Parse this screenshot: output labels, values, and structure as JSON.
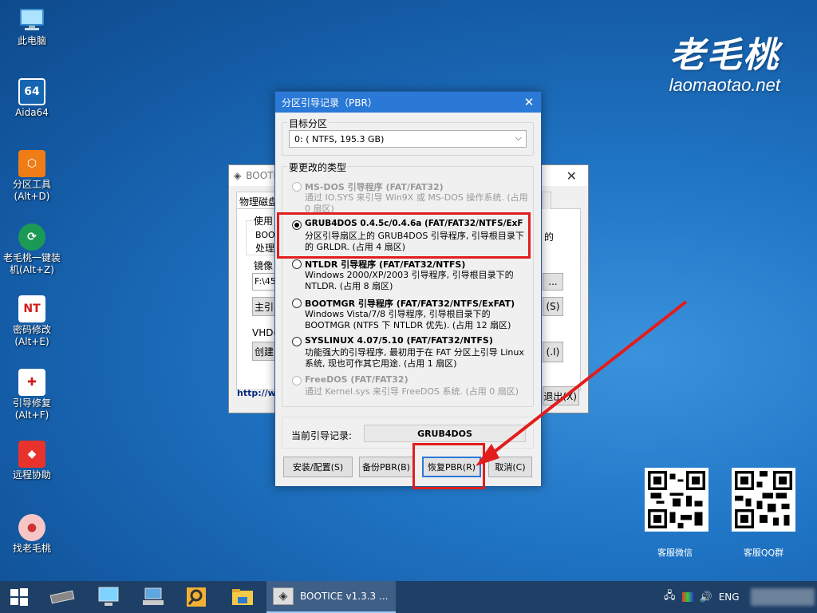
{
  "desktop": {
    "icons": [
      {
        "label": "此电脑",
        "icon": "computer-icon"
      },
      {
        "label": "Aida64",
        "icon": "aida64-icon",
        "glyph": "64"
      },
      {
        "label": "分区工具\n(Alt+D)",
        "icon": "partition-tool-icon"
      },
      {
        "label": "老毛桃一键装\n机(Alt+Z)",
        "icon": "install-icon"
      },
      {
        "label": "密码修改\n(Alt+E)",
        "icon": "password-icon"
      },
      {
        "label": "引导修复\n(Alt+F)",
        "icon": "boot-repair-icon"
      },
      {
        "label": "远程协助",
        "icon": "remote-assist-icon"
      },
      {
        "label": "找老毛桃",
        "icon": "find-laomaotao-icon"
      }
    ],
    "brand": {
      "title": "老毛桃",
      "url": "laomaotao.net"
    },
    "qr": [
      {
        "label": "客服微信"
      },
      {
        "label": "客服QQ群"
      }
    ]
  },
  "background_window": {
    "title": "BOOTI",
    "tab_label": "物理磁盘",
    "fragments": {
      "use_label": "使用",
      "boot_line": "BOOT",
      "process_line": "处理",
      "right_text": "的",
      "mirror_label": "镜像",
      "path_value": "F:\\45",
      "main_btn": "主引",
      "vhd_label": "VHD(",
      "create_btn": "创建",
      "url_text": "http://w",
      "browse_btn": "...",
      "s_btn": "(S)",
      "i_btn": "(.I)",
      "exit_btn": "退出(X)"
    }
  },
  "dialog": {
    "title": "分区引导记录（PBR）",
    "target_label": "目标分区",
    "target_value": "0: ( NTFS, 195.3 GB)",
    "type_label": "要更改的类型",
    "options": [
      {
        "name": "MS-DOS 引导程序 (FAT/FAT32)",
        "desc": "通过 IO.SYS 来引导 Win9X 或 MS-DOS 操作系统. (占用 0 扇区)",
        "selected": false,
        "enabled": false
      },
      {
        "name": "GRUB4DOS 0.4.5c/0.4.6a (FAT/FAT32/NTFS/ExF",
        "desc": "分区引导扇区上的 GRUB4DOS 引导程序, 引导根目录下的 GRLDR. (占用 4 扇区)",
        "selected": true,
        "enabled": true
      },
      {
        "name": "NTLDR 引导程序 (FAT/FAT32/NTFS)",
        "desc": "Windows 2000/XP/2003 引导程序, 引导根目录下的 NTLDR. (占用 8 扇区)",
        "selected": false,
        "enabled": true
      },
      {
        "name": "BOOTMGR 引导程序 (FAT/FAT32/NTFS/ExFAT)",
        "desc": "Windows Vista/7/8 引导程序, 引导根目录下的 BOOTMGR (NTFS 下 NTLDR 优先). (占用 12 扇区)",
        "selected": false,
        "enabled": true
      },
      {
        "name": "SYSLINUX 4.07/5.10 (FAT/FAT32/NTFS)",
        "desc": "功能强大的引导程序, 最初用于在 FAT 分区上引导 Linux 系统, 现也可作其它用途. (占用 1 扇区)",
        "selected": false,
        "enabled": true
      },
      {
        "name": "FreeDOS (FAT/FAT32)",
        "desc": "通过 Kernel.sys 来引导 FreeDOS 系统. (占用 0 扇区)",
        "selected": false,
        "enabled": false
      }
    ],
    "current_label": "当前引导记录:",
    "current_value": "GRUB4DOS",
    "buttons": {
      "install": "安装/配置(S)",
      "backup": "备份PBR(B)",
      "restore": "恢复PBR(R)",
      "cancel": "取消(C)"
    }
  },
  "taskbar": {
    "app_label": "BOOTICE v1.3.3 ...",
    "lang": "ENG"
  },
  "colors": {
    "annotation_red": "#e21d1d",
    "title_blue": "#2b79d6"
  }
}
